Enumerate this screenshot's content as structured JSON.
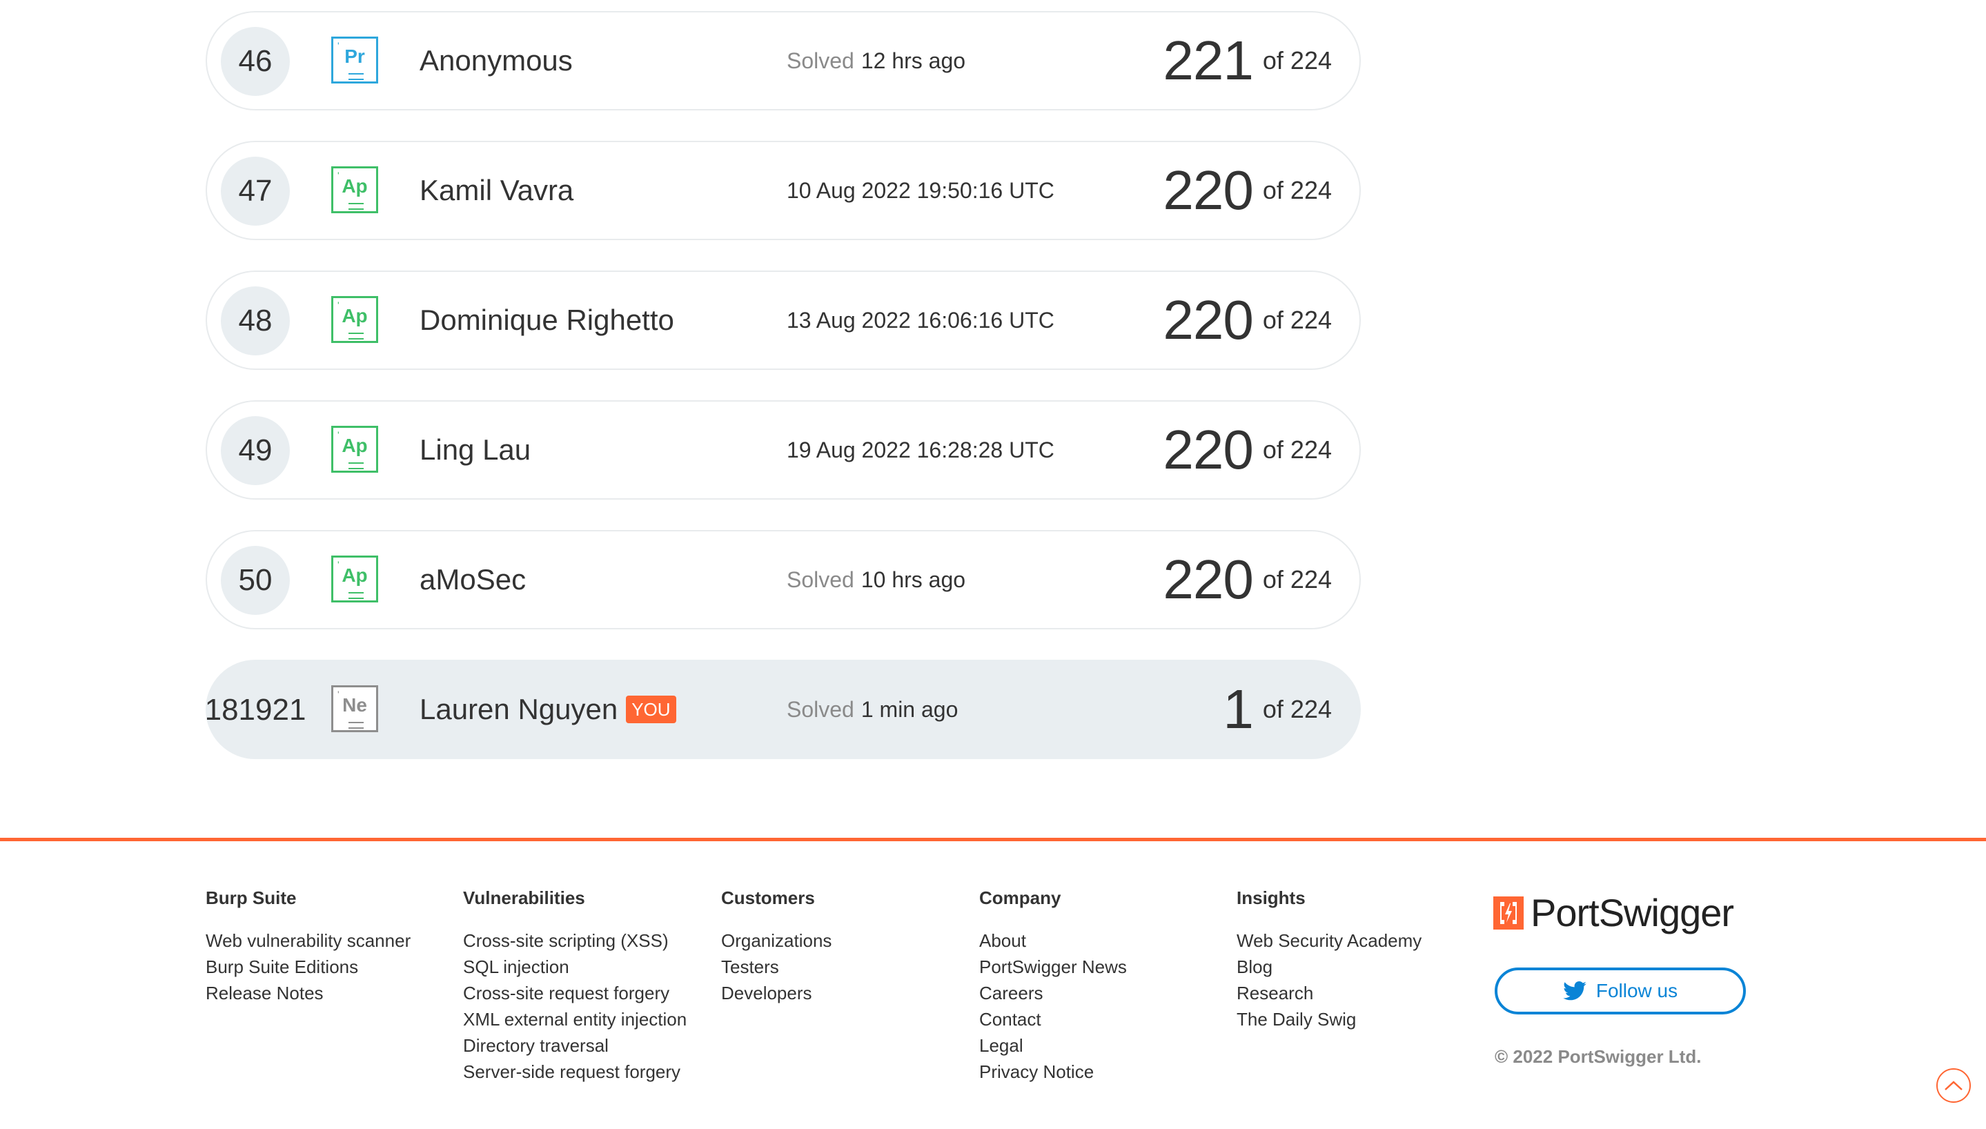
{
  "leaderboard": {
    "rows": [
      {
        "rank": "46",
        "badge": "Pr",
        "name": "Anonymous",
        "solved_prefix": "Solved",
        "solved_value": "12 hrs ago",
        "score": "221",
        "score_of": "of 224"
      },
      {
        "rank": "47",
        "badge": "Ap",
        "name": "Kamil Vavra",
        "solved_prefix": "",
        "solved_value": "10 Aug 2022 19:50:16 UTC",
        "score": "220",
        "score_of": "of 224"
      },
      {
        "rank": "48",
        "badge": "Ap",
        "name": "Dominique Righetto",
        "solved_prefix": "",
        "solved_value": "13 Aug 2022 16:06:16 UTC",
        "score": "220",
        "score_of": "of 224"
      },
      {
        "rank": "49",
        "badge": "Ap",
        "name": "Ling Lau",
        "solved_prefix": "",
        "solved_value": "19 Aug 2022 16:28:28 UTC",
        "score": "220",
        "score_of": "of 224"
      },
      {
        "rank": "50",
        "badge": "Ap",
        "name": "aMoSec",
        "solved_prefix": "Solved",
        "solved_value": "10 hrs ago",
        "score": "220",
        "score_of": "of 224"
      },
      {
        "rank": "181921",
        "badge": "Ne",
        "name": "Lauren Nguyen",
        "you_tag": "YOU",
        "solved_prefix": "Solved",
        "solved_value": "1 min ago",
        "score": "1",
        "score_of": "of 224"
      }
    ]
  },
  "footer": {
    "accent_color": "#ff6633",
    "columns": [
      {
        "heading": "Burp Suite",
        "links": [
          "Web vulnerability scanner",
          "Burp Suite Editions",
          "Release Notes"
        ]
      },
      {
        "heading": "Vulnerabilities",
        "links": [
          "Cross-site scripting (XSS)",
          "SQL injection",
          "Cross-site request forgery",
          "XML external entity injection",
          "Directory traversal",
          "Server-side request forgery"
        ]
      },
      {
        "heading": "Customers",
        "links": [
          "Organizations",
          "Testers",
          "Developers"
        ]
      },
      {
        "heading": "Company",
        "links": [
          "About",
          "PortSwigger News",
          "Careers",
          "Contact",
          "Legal",
          "Privacy Notice"
        ]
      },
      {
        "heading": "Insights",
        "links": [
          "Web Security Academy",
          "Blog",
          "Research",
          "The Daily Swig"
        ]
      }
    ],
    "logo_text": "PortSwigger",
    "follow_label": "Follow us",
    "copyright": "© 2022 PortSwigger Ltd."
  },
  "icons": {
    "logo_mark": "portswigger-logo-icon",
    "twitter": "twitter-icon",
    "scroll_top": "chevron-up-icon"
  }
}
